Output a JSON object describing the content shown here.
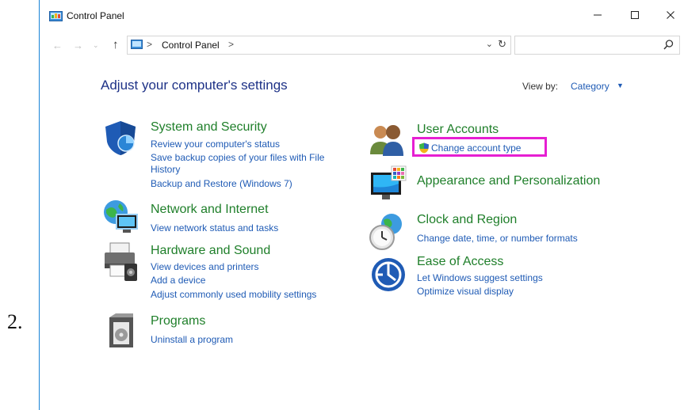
{
  "outer_label": "2.",
  "window": {
    "title": "Control Panel"
  },
  "address": {
    "crumb": "Control Panel",
    "separator": ">"
  },
  "header": {
    "title": "Adjust your computer's settings",
    "view_by_label": "View by:",
    "view_by_value": "Category"
  },
  "categories_left": [
    {
      "title": "System and Security",
      "links": [
        "Review your computer's status",
        "Save backup copies of your files with File",
        "History",
        "Backup and Restore (Windows 7)"
      ]
    },
    {
      "title": "Network and Internet",
      "links": [
        "View network status and tasks"
      ]
    },
    {
      "title": "Hardware and Sound",
      "links": [
        "View devices and printers",
        "Add a device",
        "Adjust commonly used mobility settings"
      ]
    },
    {
      "title": "Programs",
      "links": [
        "Uninstall a program"
      ]
    }
  ],
  "categories_right": [
    {
      "title": "User Accounts",
      "links": [
        "Change account type"
      ]
    },
    {
      "title": "Appearance and Personalization",
      "links": []
    },
    {
      "title": "Clock and Region",
      "links": [
        "Change date, time, or number formats"
      ]
    },
    {
      "title": "Ease of Access",
      "links": [
        "Let Windows suggest settings",
        "Optimize visual display"
      ]
    }
  ],
  "icons": {
    "app": "control-panel-icon",
    "back": "back-arrow-icon",
    "forward": "forward-arrow-icon",
    "up": "up-arrow-icon",
    "search": "search-icon",
    "system_security": "shield-icon",
    "network": "globe-network-icon",
    "hardware": "printer-sound-icon",
    "programs": "programs-box-icon",
    "user_accounts": "users-icon",
    "appearance": "monitor-palette-icon",
    "clock": "clock-globe-icon",
    "ease": "ease-of-access-icon",
    "uac": "uac-shield-icon"
  },
  "colors": {
    "category_title": "#1f7f2a",
    "link": "#1f5bb5",
    "page_title": "#1e3287",
    "highlight": "#e61fd2"
  }
}
